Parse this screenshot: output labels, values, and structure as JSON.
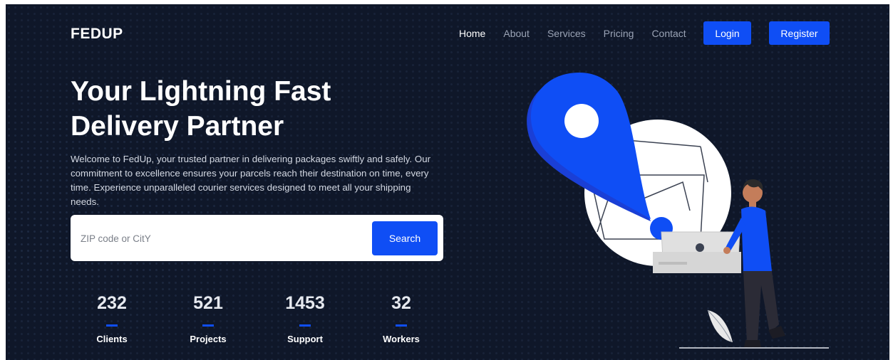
{
  "brand": {
    "logo": "FEDUP"
  },
  "nav": {
    "items": [
      {
        "label": "Home",
        "active": true
      },
      {
        "label": "About",
        "active": false
      },
      {
        "label": "Services",
        "active": false
      },
      {
        "label": "Pricing",
        "active": false
      },
      {
        "label": "Contact",
        "active": false
      }
    ],
    "login_label": "Login",
    "register_label": "Register"
  },
  "hero": {
    "title_line1": "Your Lightning Fast",
    "title_line2": "Delivery Partner",
    "description": "Welcome to FedUp, your trusted partner in delivering packages swiftly and safely. Our commitment to excellence ensures your parcels reach their destination on time, every time. Experience unparalleled courier services designed to meet all your shipping needs."
  },
  "search": {
    "placeholder": "ZIP code or CitY",
    "value": "",
    "button_label": "Search"
  },
  "stats": [
    {
      "value": "232",
      "label": "Clients"
    },
    {
      "value": "521",
      "label": "Projects"
    },
    {
      "value": "1453",
      "label": "Support"
    },
    {
      "value": "32",
      "label": "Workers"
    }
  ],
  "colors": {
    "background": "#0f1729",
    "accent": "#0f4ef5",
    "text": "#ffffff"
  },
  "illustration": {
    "icon": "map-pin-courier-illustration"
  }
}
